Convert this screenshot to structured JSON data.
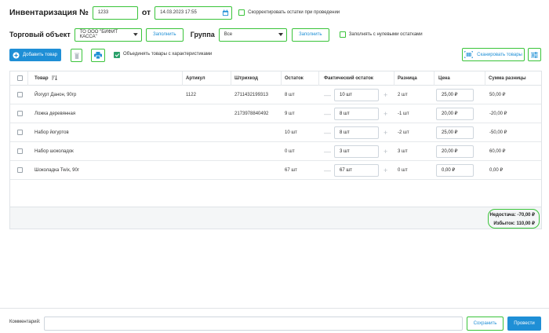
{
  "header": {
    "title": "Инвентаризация №",
    "number": "1233",
    "date_label": "от",
    "date_value": "14.03.2023 17:55",
    "adjust_label": "Скорректировать остатки при проведении"
  },
  "filters": {
    "trade_object_label": "Торговый объект",
    "trade_object_value": "ТО ООО \"БИФИТ КАССА\"",
    "fill_label": "Заполнить",
    "group_label": "Группа",
    "group_value": "Все",
    "fill_group_label": "Заполнить",
    "zero_label": "Заполнять с нулевыми остатками"
  },
  "toolbar": {
    "add_label": "Добавить товар",
    "merge_label": "Объединять товары с характеристиками",
    "scan_label": "Сканировать товары"
  },
  "table": {
    "columns": [
      "Товар",
      "Артикул",
      "Штрихкод",
      "Остаток",
      "Фактический остаток",
      "Разница",
      "Цена",
      "Сумма разницы"
    ],
    "rows": [
      {
        "name": "Йогурт Данон, 90гр",
        "article": "1122",
        "barcode": "2711432199313",
        "stock": "8 шт",
        "actual": "10 шт",
        "diff": "2 шт",
        "price": "25,00 ₽",
        "sum": "50,00 ₽"
      },
      {
        "name": "Ложка деревянная",
        "article": "",
        "barcode": "2173978840492",
        "stock": "9 шт",
        "actual": "8 шт",
        "diff": "-1 шт",
        "price": "20,00 ₽",
        "sum": "-20,00 ₽"
      },
      {
        "name": "Набор йогуртов",
        "article": "",
        "barcode": "",
        "stock": "10 шт",
        "actual": "8 шт",
        "diff": "-2 шт",
        "price": "25,00 ₽",
        "sum": "-50,00 ₽"
      },
      {
        "name": "Набор шоколадок",
        "article": "",
        "barcode": "",
        "stock": "0 шт",
        "actual": "3 шт",
        "diff": "3 шт",
        "price": "20,00 ₽",
        "sum": "60,00 ₽"
      },
      {
        "name": "Шоколадка Twix, 90г",
        "article": "",
        "barcode": "",
        "stock": "67 шт",
        "actual": "67 шт",
        "diff": "0 шт",
        "price": "0,00 ₽",
        "sum": "0,00 ₽"
      }
    ],
    "shortage": "Недостача: -70,00 ₽",
    "surplus": "Избыток: 110,00 ₽"
  },
  "footer": {
    "comment_label": "Комментарий:",
    "comment_value": "",
    "save_label": "Сохранить",
    "post_label": "Провести"
  },
  "colors": {
    "accent": "#1f8fd6",
    "highlight": "#3ac43a",
    "checked": "#2aa06a"
  },
  "icons": [
    "calendar-icon",
    "chevron-down-icon",
    "plus-circle-icon",
    "trash-icon",
    "printer-icon",
    "sort-icon",
    "barcode-scan-icon",
    "settings-sliders-icon",
    "minus-icon",
    "plus-icon"
  ]
}
